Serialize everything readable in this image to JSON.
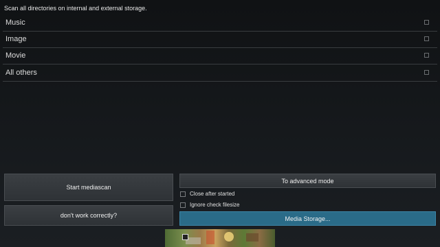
{
  "header": {
    "text": "Scan all directories on internal and external storage."
  },
  "categories": [
    {
      "label": "Music"
    },
    {
      "label": "Image"
    },
    {
      "label": "Movie"
    },
    {
      "label": "All others"
    }
  ],
  "buttons": {
    "start_mediascan": "Start mediascan",
    "dont_work": "don't work correctly?",
    "advanced_mode": "To advanced mode",
    "media_storage": "Media Storage..."
  },
  "options": {
    "close_after_started": "Close after started",
    "ignore_check_filesize": "Ignore check filesize"
  },
  "colors": {
    "accent": "#2a6b88",
    "background": "#15181b"
  }
}
